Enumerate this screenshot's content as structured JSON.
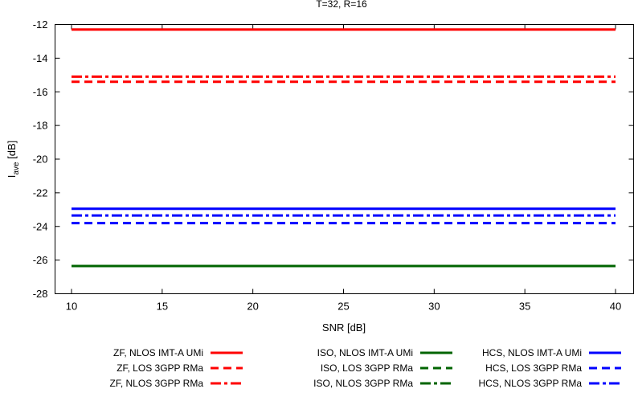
{
  "chart_data": {
    "type": "line",
    "title": "T=32, R=16",
    "xlabel": "SNR [dB]",
    "ylabel_main": "I",
    "ylabel_sub": "ave",
    "ylabel_unit": " [dB]",
    "xlim": [
      10,
      40
    ],
    "ylim": [
      -28,
      -12
    ],
    "xticks": [
      10,
      15,
      20,
      25,
      30,
      35,
      40
    ],
    "yticks": [
      -28,
      -26,
      -24,
      -22,
      -20,
      -18,
      -16,
      -14,
      -12
    ],
    "grid": false,
    "legend_position": "bottom",
    "series": [
      {
        "name": "ZF, NLOS IMT-A UMi",
        "color": "#ff0000",
        "style": "solid",
        "x": [
          10,
          40
        ],
        "values": [
          -12.3,
          -12.3
        ]
      },
      {
        "name": "ZF, LOS 3GPP RMa",
        "color": "#ff0000",
        "style": "dashed",
        "x": [
          10,
          40
        ],
        "values": [
          -15.4,
          -15.4
        ]
      },
      {
        "name": "ZF, NLOS 3GPP RMa",
        "color": "#ff0000",
        "style": "dashdot",
        "x": [
          10,
          40
        ],
        "values": [
          -15.1,
          -15.1
        ]
      },
      {
        "name": "ISO, NLOS IMT-A UMi",
        "color": "#006400",
        "style": "solid",
        "x": [
          10,
          40
        ],
        "values": [
          -26.35,
          -26.35
        ]
      },
      {
        "name": "ISO, LOS 3GPP RMa",
        "color": "#006400",
        "style": "dashed",
        "x": [
          10,
          40
        ],
        "values": [
          -26.35,
          -26.35
        ]
      },
      {
        "name": "ISO, NLOS 3GPP RMa",
        "color": "#006400",
        "style": "dashdot",
        "x": [
          10,
          40
        ],
        "values": [
          -26.35,
          -26.35
        ]
      },
      {
        "name": "HCS, NLOS IMT-A UMi",
        "color": "#0000ff",
        "style": "solid",
        "x": [
          10,
          40
        ],
        "values": [
          -22.95,
          -22.95
        ]
      },
      {
        "name": "HCS, LOS 3GPP RMa",
        "color": "#0000ff",
        "style": "dashed",
        "x": [
          10,
          40
        ],
        "values": [
          -23.8,
          -23.8
        ]
      },
      {
        "name": "HCS, NLOS 3GPP RMa",
        "color": "#0000ff",
        "style": "dashdot",
        "x": [
          10,
          40
        ],
        "values": [
          -23.35,
          -23.35
        ]
      }
    ]
  }
}
